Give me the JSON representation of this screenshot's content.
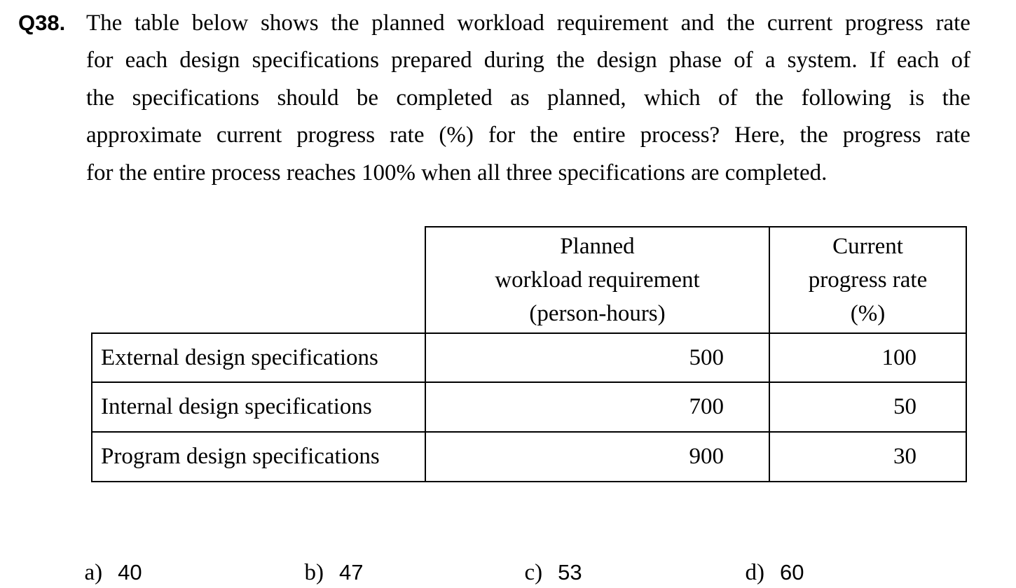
{
  "question": {
    "number": "Q38.",
    "lines": [
      "The table below shows the planned workload requirement and the current progress rate",
      "for each design specifications prepared during the design phase of a system.    If each of",
      "the specifications should be completed as planned, which of the following is the",
      "approximate current progress rate (%) for the entire process?    Here, the progress rate",
      "for the entire process reaches 100% when all three specifications are completed."
    ]
  },
  "table": {
    "headers": {
      "workload": [
        "Planned",
        "workload requirement",
        "(person-hours)"
      ],
      "progress": [
        "Current",
        "progress rate",
        "(%)"
      ]
    },
    "rows": [
      {
        "name": "External design specifications",
        "workload": "500",
        "progress": "100"
      },
      {
        "name": "Internal design specifications",
        "workload": "700",
        "progress": "50"
      },
      {
        "name": "Program design specifications",
        "workload": "900",
        "progress": "30"
      }
    ]
  },
  "options": [
    {
      "letter": "a)",
      "value": "40"
    },
    {
      "letter": "b)",
      "value": "47"
    },
    {
      "letter": "c)",
      "value": "53"
    },
    {
      "letter": "d)",
      "value": "60"
    }
  ]
}
